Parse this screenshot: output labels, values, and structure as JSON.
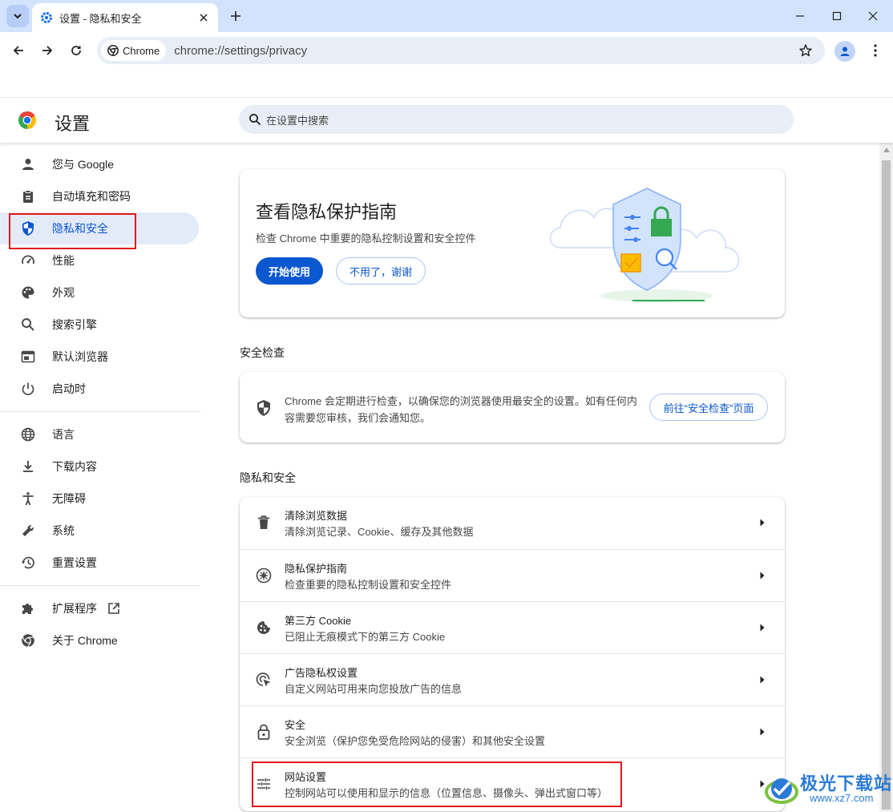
{
  "browser": {
    "tab_title": "设置 - 隐私和安全",
    "chip_label": "Chrome",
    "url": "chrome://settings/privacy"
  },
  "header": {
    "title": "设置",
    "search_placeholder": "在设置中搜索"
  },
  "sidebar": {
    "items": [
      {
        "label": "您与 Google",
        "icon": "person-icon"
      },
      {
        "label": "自动填充和密码",
        "icon": "clipboard-icon"
      },
      {
        "label": "隐私和安全",
        "icon": "shield-icon",
        "active": true
      },
      {
        "label": "性能",
        "icon": "speedometer-icon"
      },
      {
        "label": "外观",
        "icon": "palette-icon"
      },
      {
        "label": "搜索引擎",
        "icon": "search-icon"
      },
      {
        "label": "默认浏览器",
        "icon": "browser-icon"
      },
      {
        "label": "启动时",
        "icon": "power-icon"
      },
      {
        "label": "语言",
        "icon": "globe-icon"
      },
      {
        "label": "下载内容",
        "icon": "download-icon"
      },
      {
        "label": "无障碍",
        "icon": "accessibility-icon"
      },
      {
        "label": "系统",
        "icon": "wrench-icon"
      },
      {
        "label": "重置设置",
        "icon": "history-icon"
      },
      {
        "label": "扩展程序",
        "icon": "puzzle-icon"
      },
      {
        "label": "关于 Chrome",
        "icon": "chrome-icon"
      }
    ]
  },
  "promo": {
    "title": "查看隐私保护指南",
    "desc": "检查 Chrome 中重要的隐私控制设置和安全控件",
    "primary_btn": "开始使用",
    "secondary_btn": "不用了，谢谢"
  },
  "safety_check": {
    "section_title": "安全检查",
    "text": "Chrome 会定期进行检查，以确保您的浏览器使用最安全的设置。如有任何内容需要您审核，我们会通知您。",
    "button": "前往“安全检查”页面"
  },
  "privacy": {
    "section_title": "隐私和安全",
    "rows": [
      {
        "title": "清除浏览数据",
        "desc": "清除浏览记录、Cookie、缓存及其他数据",
        "icon": "trash-icon"
      },
      {
        "title": "隐私保护指南",
        "desc": "检查重要的隐私控制设置和安全控件",
        "icon": "compass-icon"
      },
      {
        "title": "第三方 Cookie",
        "desc": "已阻止无痕模式下的第三方 Cookie",
        "icon": "cookie-icon"
      },
      {
        "title": "广告隐私权设置",
        "desc": "自定义网站可用来向您投放广告的信息",
        "icon": "ads-icon"
      },
      {
        "title": "安全",
        "desc": "安全浏览（保护您免受危险网站的侵害）和其他安全设置",
        "icon": "lock-icon"
      },
      {
        "title": "网站设置",
        "desc": "控制网站可以使用和显示的信息（位置信息、摄像头、弹出式窗口等）",
        "icon": "tune-icon"
      }
    ]
  },
  "watermark": {
    "line1": "极光下载站",
    "line2": "www.xz7.com"
  },
  "colors": {
    "accent": "#0b57d0",
    "tabstrip": "#d3e3fd",
    "highlight_box": "#e3171c"
  }
}
